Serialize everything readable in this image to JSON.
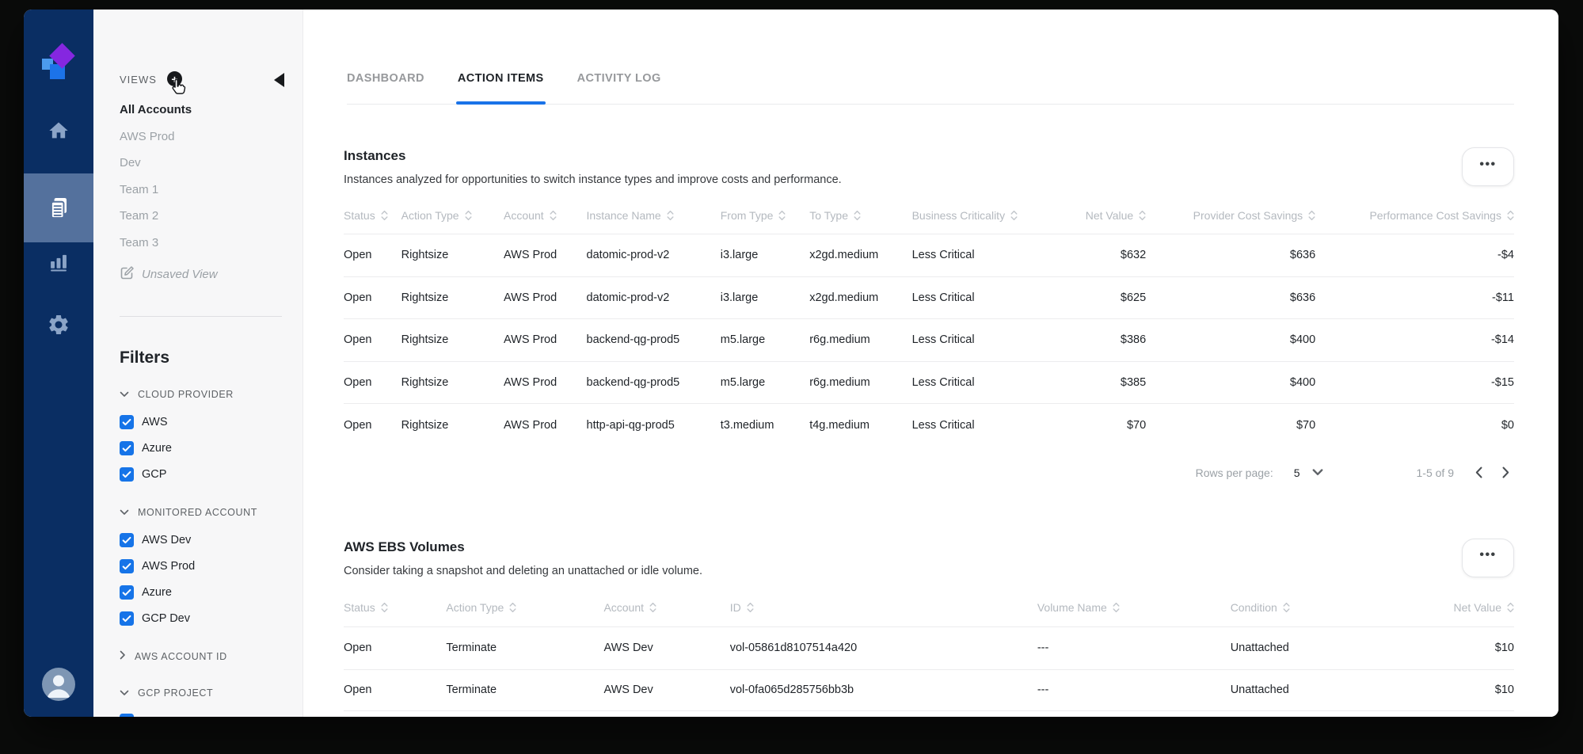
{
  "colors": {
    "accent": "#1a73e8",
    "sidebar": "#0a2e63",
    "sidebar_selected": "#54719d",
    "checkbox_blue": "#1674e8"
  },
  "rail": {
    "icons": [
      "logo-icon",
      "home-icon",
      "documents-icon",
      "bar-chart-icon",
      "gear-icon",
      "avatar-icon"
    ]
  },
  "views": {
    "header": "VIEWS",
    "add_icon": "plus-icon",
    "cursor_icon": "hand-cursor-icon",
    "collapse_icon": "collapse-left-icon",
    "items": [
      {
        "label": "All Accounts",
        "active": true
      },
      {
        "label": "AWS Prod",
        "active": false
      },
      {
        "label": "Dev",
        "active": false
      },
      {
        "label": "Team 1",
        "active": false
      },
      {
        "label": "Team 2",
        "active": false
      },
      {
        "label": "Team 3",
        "active": false
      }
    ],
    "unsaved": {
      "label": "Unsaved View",
      "icon": "edit-icon"
    }
  },
  "filters": {
    "title": "Filters",
    "groups": [
      {
        "label": "CLOUD PROVIDER",
        "expanded": true,
        "items": [
          {
            "label": "AWS",
            "checked": true
          },
          {
            "label": "Azure",
            "checked": true
          },
          {
            "label": "GCP",
            "checked": true
          }
        ]
      },
      {
        "label": "MONITORED ACCOUNT",
        "expanded": true,
        "items": [
          {
            "label": "AWS Dev",
            "checked": true
          },
          {
            "label": "AWS Prod",
            "checked": true
          },
          {
            "label": "Azure",
            "checked": true
          },
          {
            "label": "GCP Dev",
            "checked": true
          }
        ]
      },
      {
        "label": "AWS ACCOUNT ID",
        "expanded": false,
        "items": []
      },
      {
        "label": "GCP PROJECT",
        "expanded": true,
        "items": [
          {
            "label": "",
            "checked": true
          }
        ]
      }
    ]
  },
  "tabs": [
    {
      "label": "DASHBOARD",
      "active": false
    },
    {
      "label": "ACTION ITEMS",
      "active": true
    },
    {
      "label": "ACTIVITY LOG",
      "active": false
    }
  ],
  "instances": {
    "title": "Instances",
    "subtitle": "Instances analyzed for opportunities to switch instance types and improve costs and performance.",
    "menu_icon": "ellipsis-icon",
    "menu_glyph": "•••",
    "columns": [
      {
        "label": "Status",
        "align": "left"
      },
      {
        "label": "Action Type",
        "align": "left"
      },
      {
        "label": "Account",
        "align": "left"
      },
      {
        "label": "Instance Name",
        "align": "left"
      },
      {
        "label": "From Type",
        "align": "left"
      },
      {
        "label": "To Type",
        "align": "left"
      },
      {
        "label": "Business Criticality",
        "align": "left"
      },
      {
        "label": "Net Value",
        "align": "right"
      },
      {
        "label": "Provider Cost Savings",
        "align": "right"
      },
      {
        "label": "Performance Cost Savings",
        "align": "right"
      }
    ],
    "rows": [
      [
        "Open",
        "Rightsize",
        "AWS Prod",
        "datomic-prod-v2",
        "i3.large",
        "x2gd.medium",
        "Less Critical",
        "$632",
        "$636",
        "-$4"
      ],
      [
        "Open",
        "Rightsize",
        "AWS Prod",
        "datomic-prod-v2",
        "i3.large",
        "x2gd.medium",
        "Less Critical",
        "$625",
        "$636",
        "-$11"
      ],
      [
        "Open",
        "Rightsize",
        "AWS Prod",
        "backend-qg-prod5",
        "m5.large",
        "r6g.medium",
        "Less Critical",
        "$386",
        "$400",
        "-$14"
      ],
      [
        "Open",
        "Rightsize",
        "AWS Prod",
        "backend-qg-prod5",
        "m5.large",
        "r6g.medium",
        "Less Critical",
        "$385",
        "$400",
        "-$15"
      ],
      [
        "Open",
        "Rightsize",
        "AWS Prod",
        "http-api-qg-prod5",
        "t3.medium",
        "t4g.medium",
        "Less Critical",
        "$70",
        "$70",
        "$0"
      ]
    ],
    "pagination": {
      "rows_per_page_label": "Rows per page:",
      "rows_per_page": "5",
      "range": "1-5 of 9",
      "icons": [
        "chevron-down-icon",
        "chevron-left-icon",
        "chevron-right-icon"
      ]
    }
  },
  "ebs": {
    "title": "AWS EBS Volumes",
    "subtitle": "Consider taking a snapshot and deleting an unattached or idle volume.",
    "menu_icon": "ellipsis-icon",
    "menu_glyph": "•••",
    "columns": [
      {
        "label": "Status",
        "align": "left"
      },
      {
        "label": "Action Type",
        "align": "left"
      },
      {
        "label": "Account",
        "align": "left"
      },
      {
        "label": "ID",
        "align": "left"
      },
      {
        "label": "Volume Name",
        "align": "left"
      },
      {
        "label": "Condition",
        "align": "left"
      },
      {
        "label": "Net Value",
        "align": "right"
      }
    ],
    "rows": [
      [
        "Open",
        "Terminate",
        "AWS Dev",
        "vol-05861d8107514a420",
        "---",
        "Unattached",
        "$10"
      ],
      [
        "Open",
        "Terminate",
        "AWS Dev",
        "vol-0fa065d285756bb3b",
        "---",
        "Unattached",
        "$10"
      ]
    ]
  }
}
